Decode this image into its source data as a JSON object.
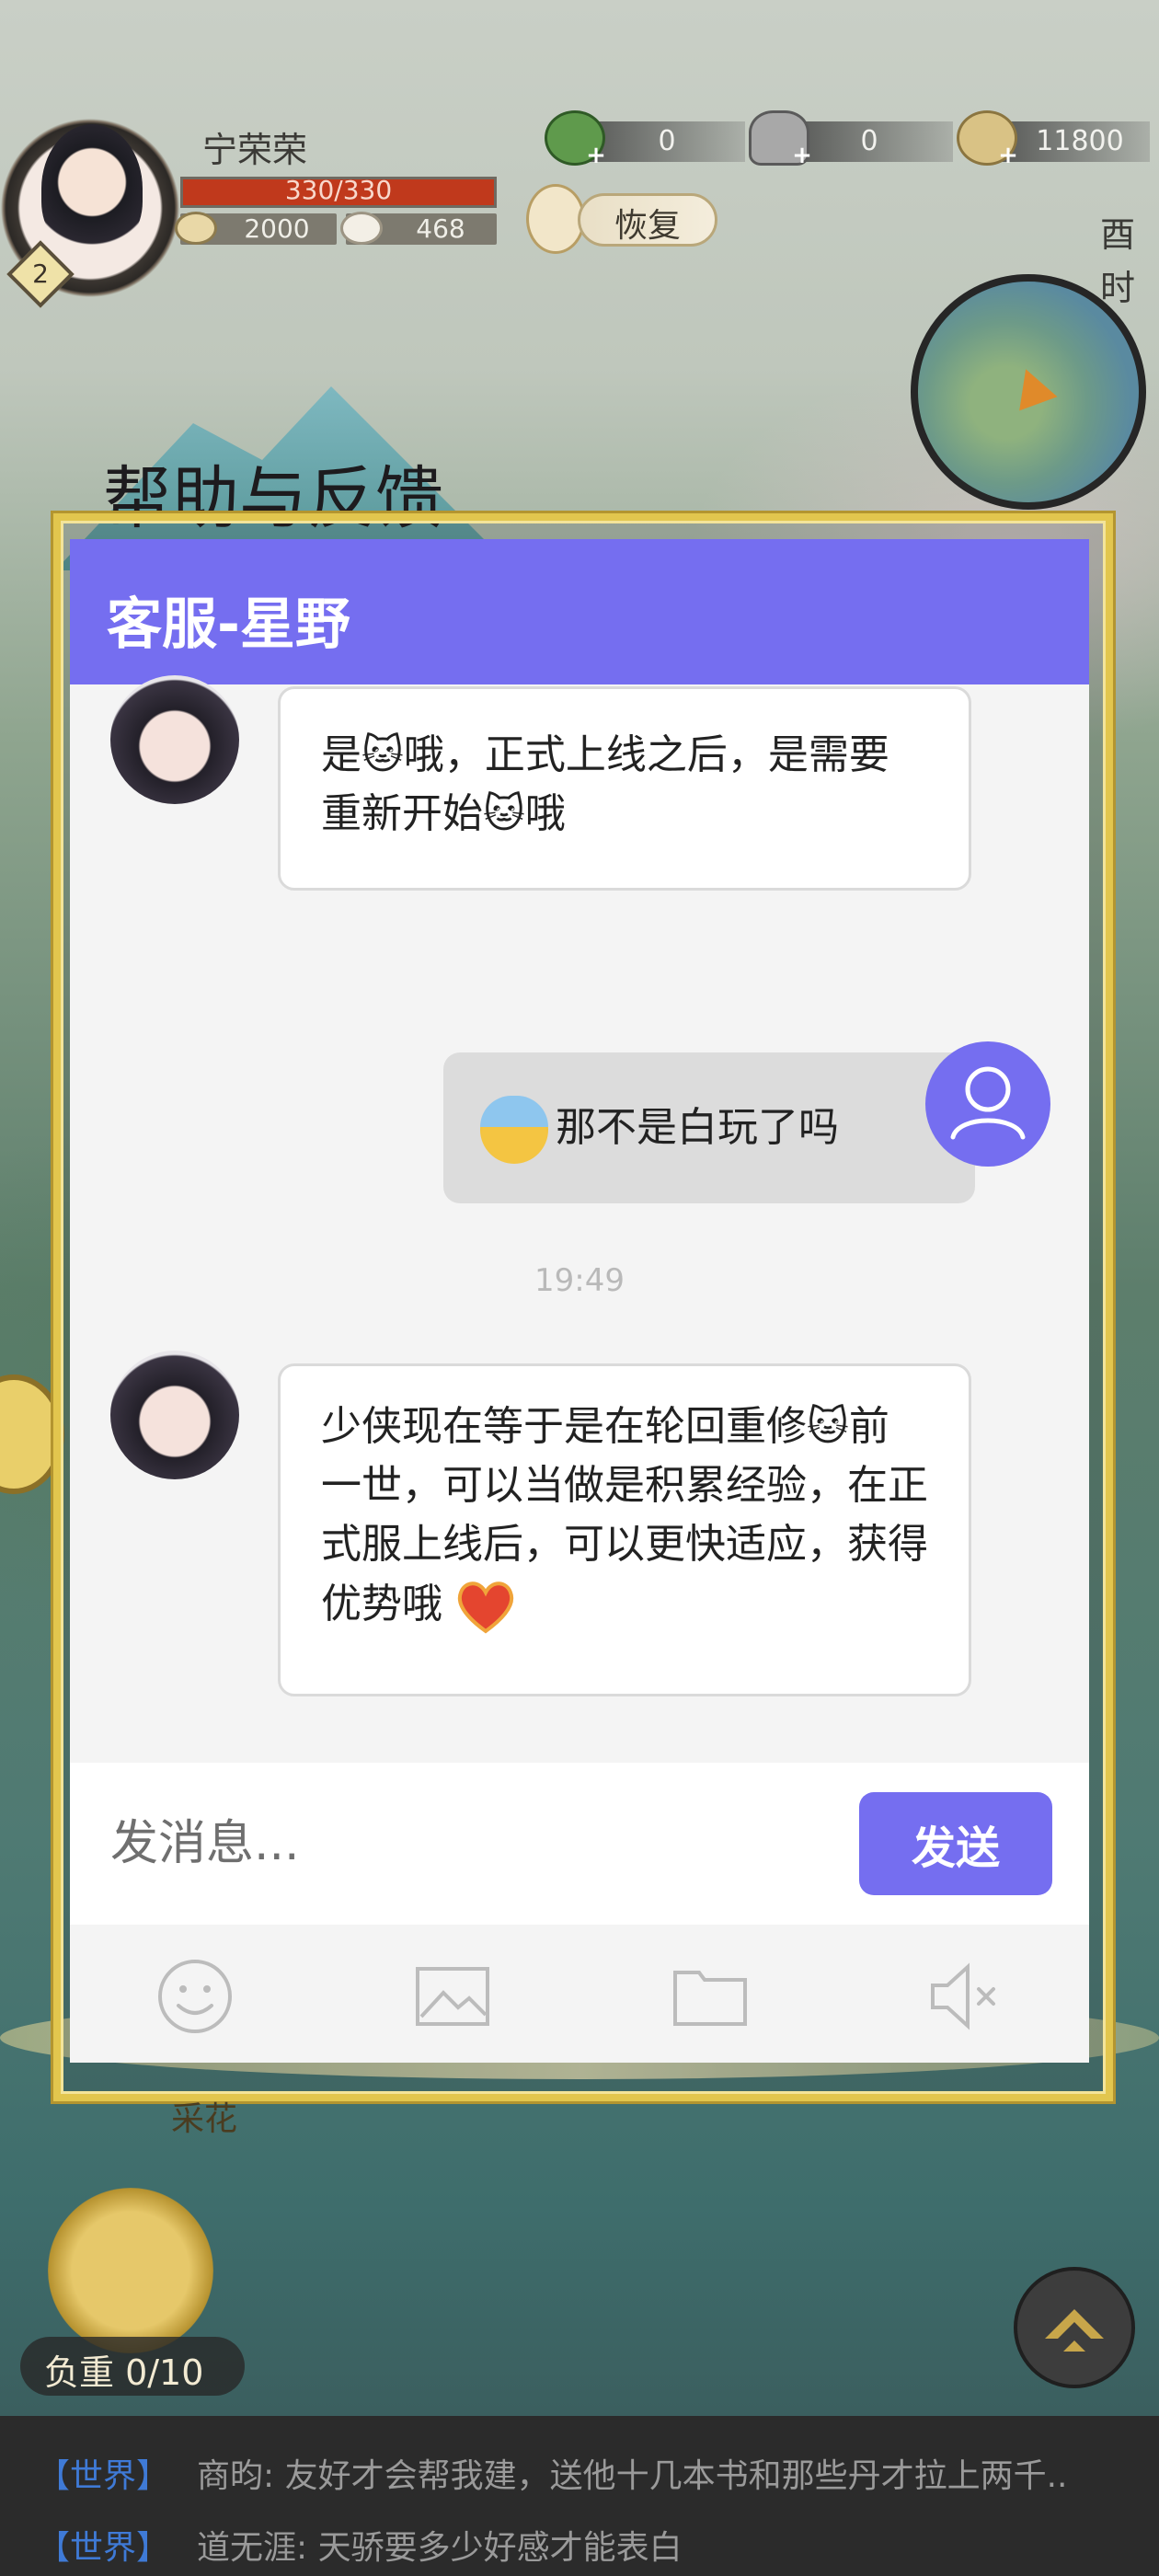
{
  "hud": {
    "player_name": "宁荣荣",
    "level": "2",
    "hp": "330/330",
    "stat_left": "2000",
    "stat_right": "468",
    "resources": [
      "0",
      "0",
      "11800"
    ],
    "restore_label": "恢复",
    "time_label": "酉时"
  },
  "dialog": {
    "title": "帮助与反馈",
    "header_title": "客服-星野",
    "messages": {
      "m1": "是🐱哦，正式上线之后，是需要重新开始🐱哦",
      "m2": "那不是白玩了吗",
      "timestamp": "19:49",
      "m3": "少侠现在等于是在轮回重修🐱前一世，可以当做是积累经验，在正式服上线后，可以更快适应，获得优势哦"
    },
    "input_placeholder": "发消息...",
    "send_label": "发送"
  },
  "bottom_hud": {
    "harvest_label": "采花",
    "load_label": "负重 0/10"
  },
  "world_chat": [
    {
      "channel": "【世界】",
      "sender": "商昀:",
      "text": "友好才会帮我建，送他十几本书和那些丹才拉上两千.."
    },
    {
      "channel": "【世界】",
      "sender": "道无涯:",
      "text": "天骄要多少好感才能表白"
    }
  ],
  "colors": {
    "accent": "#756ef0",
    "frame_gold": "#e2c64e",
    "channel_blue": "#3f7ad6"
  },
  "icons": {
    "toolbar": [
      "smiley-icon",
      "image-icon",
      "folder-icon",
      "mute-icon"
    ]
  }
}
